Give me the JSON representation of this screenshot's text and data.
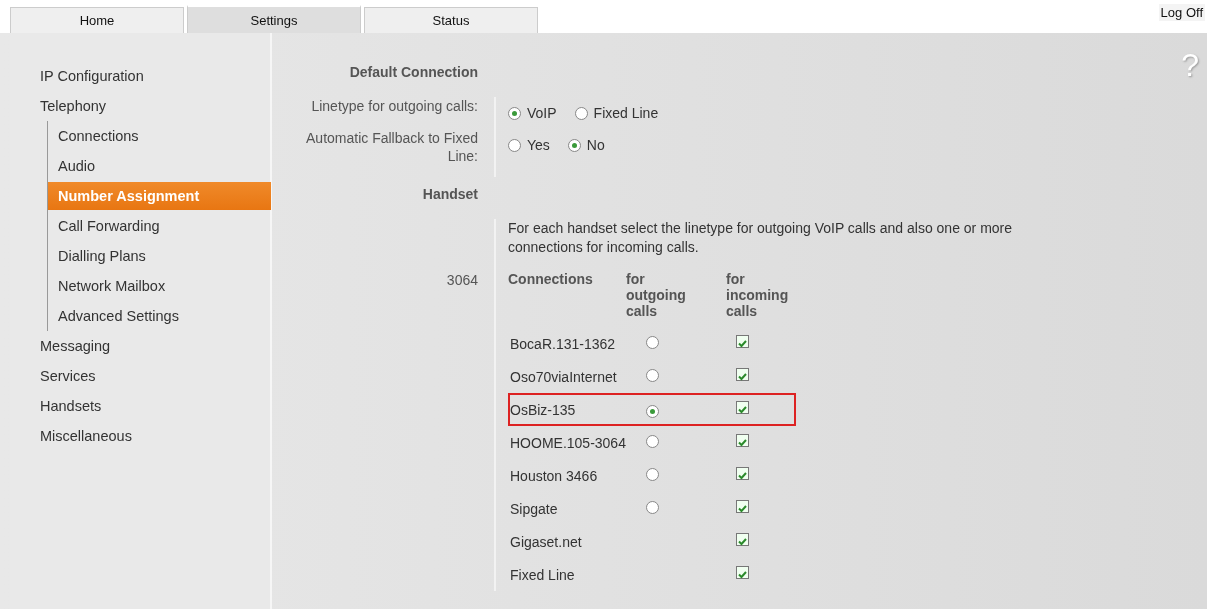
{
  "tabs": [
    {
      "label": "Home",
      "selected": false
    },
    {
      "label": "Settings",
      "selected": true
    },
    {
      "label": "Status",
      "selected": false
    }
  ],
  "logoff": "Log Off",
  "help": "?",
  "sidebar": {
    "items": [
      {
        "label": "IP Configuration",
        "selected": false
      },
      {
        "label": "Telephony",
        "selected": false,
        "children": [
          {
            "label": "Connections",
            "selected": false
          },
          {
            "label": "Audio",
            "selected": false
          },
          {
            "label": "Number Assignment",
            "selected": true
          },
          {
            "label": "Call Forwarding",
            "selected": false
          },
          {
            "label": "Dialling Plans",
            "selected": false
          },
          {
            "label": "Network Mailbox",
            "selected": false
          },
          {
            "label": "Advanced Settings",
            "selected": false
          }
        ]
      },
      {
        "label": "Messaging",
        "selected": false
      },
      {
        "label": "Services",
        "selected": false
      },
      {
        "label": "Handsets",
        "selected": false
      },
      {
        "label": "Miscellaneous",
        "selected": false
      }
    ]
  },
  "default_connection": {
    "heading": "Default Connection",
    "fields": [
      {
        "label": "Linetype for outgoing calls:",
        "options": [
          {
            "label": "VoIP",
            "selected": true
          },
          {
            "label": "Fixed Line",
            "selected": false
          }
        ]
      },
      {
        "label": "Automatic Fallback to Fixed Line:",
        "options": [
          {
            "label": "Yes",
            "selected": false
          },
          {
            "label": "No",
            "selected": true
          }
        ]
      }
    ]
  },
  "handset": {
    "heading": "Handset",
    "description": "For each handset select the linetype for outgoing VoIP calls and also one or more connections for incoming calls.",
    "name": "3064",
    "columns": [
      "Connections",
      "for outgoing calls",
      "for incoming calls"
    ],
    "rows": [
      {
        "name": "BocaR.131-1362",
        "kind": "both",
        "selected": false,
        "incoming": true,
        "highlighted": false
      },
      {
        "name": "Oso70viaInternet",
        "kind": "both",
        "selected": false,
        "incoming": true,
        "highlighted": false
      },
      {
        "name": "OsBiz-135",
        "kind": "both",
        "selected": true,
        "incoming": true,
        "highlighted": true
      },
      {
        "name": "HOOME.105-3064",
        "kind": "both",
        "selected": false,
        "incoming": true,
        "highlighted": false
      },
      {
        "name": "Houston 3466",
        "kind": "both",
        "selected": false,
        "incoming": true,
        "highlighted": false
      },
      {
        "name": "Sipgate",
        "kind": "both",
        "selected": false,
        "incoming": true,
        "highlighted": false
      },
      {
        "name": "Gigaset.net",
        "kind": "incoming",
        "incoming": true,
        "highlighted": false
      },
      {
        "name": "Fixed Line",
        "kind": "incoming",
        "incoming": true,
        "highlighted": false
      }
    ]
  }
}
